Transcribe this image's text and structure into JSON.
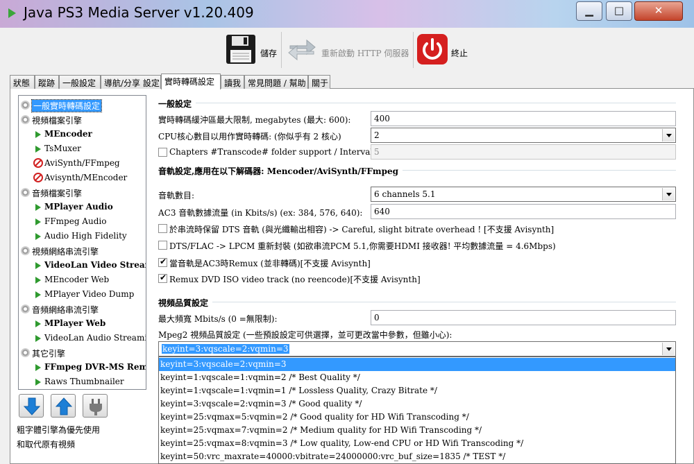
{
  "window": {
    "title": "Java PS3 Media Server v1.20.409",
    "min_glyph": "▁",
    "max_glyph": "□",
    "close_glyph": "✕"
  },
  "toolbar": {
    "save": "儲存",
    "restart": "重新啟動 HTTP 伺服器",
    "quit": "終止"
  },
  "tabs": [
    "狀態",
    "蹤跡",
    "一般設定",
    "導航/分享 設定",
    "實時轉碼設定",
    "讀我",
    "常見問題 / 幫助",
    "關于"
  ],
  "active_tab": "實時轉碼設定",
  "tree": {
    "items": [
      {
        "label": "一般實時轉碼設定",
        "icon": "gear-icon",
        "level": 0,
        "bold": false,
        "selected": true
      },
      {
        "label": "視頻檔案引擎",
        "icon": "gear-icon",
        "level": 0,
        "bold": false
      },
      {
        "label": "MEncoder",
        "icon": "play-icon",
        "level": 1,
        "bold": true
      },
      {
        "label": "TsMuxer",
        "icon": "play-icon",
        "level": 1,
        "bold": false
      },
      {
        "label": "AviSynth/FFmpeg",
        "icon": "disabled-icon",
        "level": 1,
        "bold": false
      },
      {
        "label": "Avisynth/MEncoder",
        "icon": "disabled-icon",
        "level": 1,
        "bold": false
      },
      {
        "label": "音頻檔案引擎",
        "icon": "gear-icon",
        "level": 0,
        "bold": false
      },
      {
        "label": "MPlayer Audio",
        "icon": "play-icon",
        "level": 1,
        "bold": true
      },
      {
        "label": "FFmpeg Audio",
        "icon": "play-icon",
        "level": 1,
        "bold": false
      },
      {
        "label": "Audio High Fidelity",
        "icon": "play-icon",
        "level": 1,
        "bold": false
      },
      {
        "label": "視頻網絡串流引擎",
        "icon": "gear-icon",
        "level": 0,
        "bold": false
      },
      {
        "label": "VideoLan Video Streaming",
        "icon": "play-icon",
        "level": 1,
        "bold": true
      },
      {
        "label": "MEncoder Web",
        "icon": "play-icon",
        "level": 1,
        "bold": false
      },
      {
        "label": "MPlayer Video Dump",
        "icon": "play-icon",
        "level": 1,
        "bold": false
      },
      {
        "label": "音頻網絡串流引擎",
        "icon": "gear-icon",
        "level": 0,
        "bold": false
      },
      {
        "label": "MPlayer Web",
        "icon": "play-icon",
        "level": 1,
        "bold": true
      },
      {
        "label": "VideoLan Audio Streaming",
        "icon": "play-icon",
        "level": 1,
        "bold": false
      },
      {
        "label": "其它引擎",
        "icon": "gear-icon",
        "level": 0,
        "bold": false
      },
      {
        "label": "FFmpeg DVR-MS Remux",
        "icon": "play-icon",
        "level": 1,
        "bold": true
      },
      {
        "label": "Raws Thumbnailer",
        "icon": "play-icon",
        "level": 1,
        "bold": false
      }
    ]
  },
  "notes": {
    "line1": "粗字體引擎為優先使用",
    "line2": "和取代原有視頻"
  },
  "general": {
    "title": "一般設定",
    "buffer_label": "實時轉碼緩沖區最大限制, megabytes (最大: 600):",
    "buffer_value": "400",
    "cpu_label": "CPU核心數目以用作實時轉碼: (你似乎有 2 核心)",
    "cpu_value": "2",
    "chapters_label": "Chapters #Transcode# folder support / Interval in minutes:",
    "chapters_checked": false,
    "chapters_value": "5"
  },
  "audio": {
    "title": "音軌設定,應用在以下解碼器: Mencoder/AviSynth/FFmpeg",
    "channels_label": "音軌數目:",
    "channels_value": "6 channels 5.1",
    "ac3_label": "AC3 音軌數據流量 (in Kbits/s) (ex: 384, 576, 640):",
    "ac3_value": "640",
    "dts_keep_label": "於串流時保留 DTS 音軌 (與光纖輸出相容) -> Careful, slight bitrate overhead ! [不支援 Avisynth]",
    "dts_keep_checked": false,
    "lpcm_label": "DTS/FLAC -> LPCM 重新封裝 (如欲串流PCM 5.1,你需要HDMI 接收器! 平均數據流量 = 4.6Mbps)",
    "lpcm_checked": false,
    "remux_ac3_label": "當音軌是AC3時Remux (並非轉碼)[不支援 Avisynth]",
    "remux_ac3_checked": true,
    "remux_dvd_label": "Remux DVD ISO video track (no reencode)[不支援 Avisynth]",
    "remux_dvd_checked": true
  },
  "video": {
    "title": "視頻品質設定",
    "bw_label": "最大頻寬 Mbits/s (0 =無限制):",
    "bw_value": "0",
    "mpeg2_label": "Mpeg2 視頻品質設定 (一些預設設定可供選擇，並可更改當中參數，但雖小心):",
    "mpeg2_value": "keyint=3:vqscale=2:vqmin=3",
    "mpeg2_options": [
      "keyint=3:vqscale=2:vqmin=3",
      "keyint=1:vqscale=1:vqmin=2  /* Best Quality */",
      "keyint=1:vqscale=1:vqmin=1  /* Lossless Quality, Crazy Bitrate */",
      "keyint=3:vqscale=2:vqmin=3  /* Good quality */",
      "keyint=25:vqmax=5:vqmin=2  /* Good quality for HD Wifi Transcoding */",
      "keyint=25:vqmax=7:vqmin=2  /* Medium quality for HD Wifi Transcoding */",
      "keyint=25:vqmax=8:vqmin=3  /* Low quality, Low-end CPU or HD Wifi Transcoding */",
      "keyint=50:vrc_maxrate=40000:vbitrate=24000000:vrc_buf_size=1835  /* TEST */"
    ]
  }
}
